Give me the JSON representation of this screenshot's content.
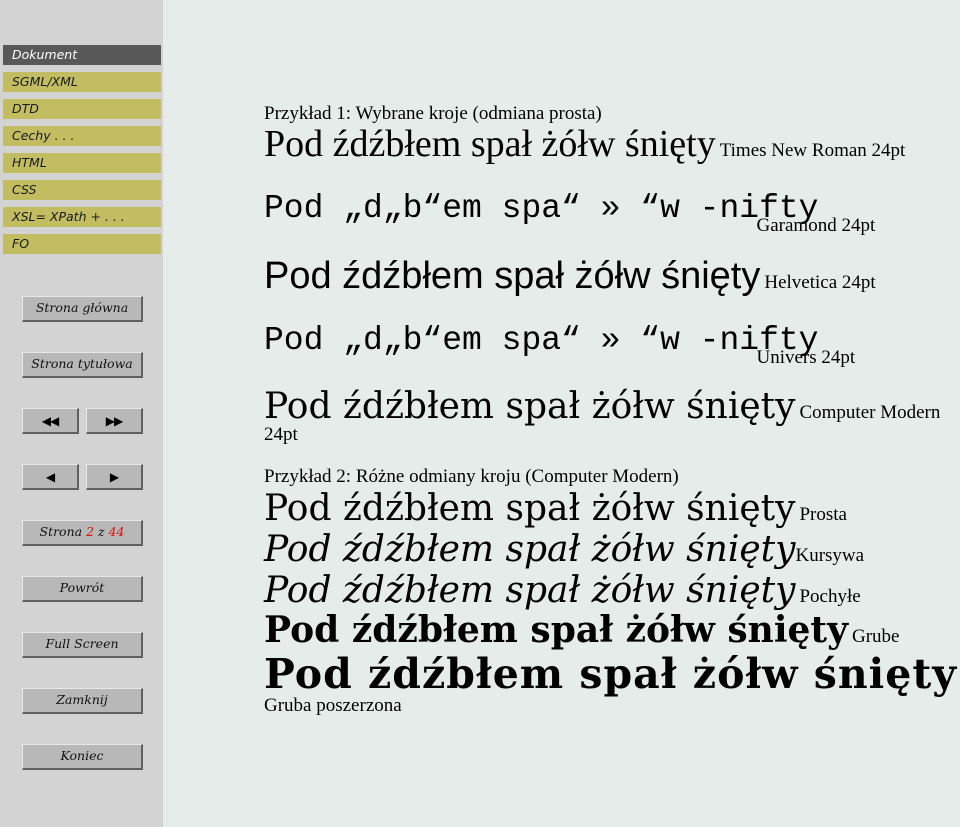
{
  "sidebar": {
    "toc": [
      {
        "label": "Dokument",
        "current": true
      },
      {
        "label": "SGML/XML",
        "current": false
      },
      {
        "label": "DTD",
        "current": false
      },
      {
        "label": "Cechy . . .",
        "current": false
      },
      {
        "label": "HTML",
        "current": false
      },
      {
        "label": "CSS",
        "current": false
      },
      {
        "label": "XSL= XPath + . . .",
        "current": false
      },
      {
        "label": "FO",
        "current": false
      }
    ],
    "buttons": {
      "home": "Strona główna",
      "title_page": "Strona tytułowa",
      "first": "◀◀",
      "last": "▶▶",
      "prev": "◀",
      "next": "▶",
      "page_prefix": "Strona",
      "page_current": "2",
      "page_sep": "z",
      "page_total": "44",
      "back": "Powrót",
      "fullscreen": "Full Screen",
      "close": "Zamknij",
      "quit": "Koniec"
    },
    "colors": {
      "sidebar_bg": "#d3d3d3",
      "toc_item_bg": "#c3bd62",
      "toc_current_bg": "#585858",
      "button_bg": "#b8b8b8",
      "page_number_red": "#d41414"
    }
  },
  "content": {
    "background": "#e5ecea",
    "example1": {
      "caption": "Przykład 1: Wybrane kroje (odmiana prosta)",
      "samples": [
        {
          "text": "Pod źdźbłem spał żółw śnięty",
          "label": "Times New Roman 24pt",
          "family": "times"
        },
        {
          "text": "Pod „d„b“em spa“ » “w -nifty",
          "label": "Garamond 24pt",
          "family": "mono"
        },
        {
          "text": "Pod źdźbłem spał żółw śnięty",
          "label": "Helvetica 24pt",
          "family": "helvetica"
        },
        {
          "text": "Pod „d„b“em spa“ » “w -nifty",
          "label": "Univers 24pt",
          "family": "mono"
        },
        {
          "text": "Pod źdźbłem spał żółw śnięty",
          "label": "Computer Modern 24pt",
          "family": "computer-modern"
        }
      ]
    },
    "example2": {
      "caption": "Przykład 2: Różne odmiany kroju (Computer Modern)",
      "samples": [
        {
          "text": "Pod źdźbłem spał żółw śnięty",
          "label": "Prosta",
          "variant": "regular"
        },
        {
          "text": "Pod źdźbłem spał żółw śnięty",
          "label": "Kursywa",
          "variant": "italic"
        },
        {
          "text": "Pod źdźbłem spał żółw śnięty",
          "label": "Pochyłe",
          "variant": "oblique"
        },
        {
          "text": "Pod źdźbłem spał żółw śnięty",
          "label": "Grube",
          "variant": "bold"
        },
        {
          "text": "Pod źdźbłem spał żółw śnięty",
          "label": "Gruba poszerzona",
          "variant": "bold-extended"
        }
      ]
    }
  }
}
